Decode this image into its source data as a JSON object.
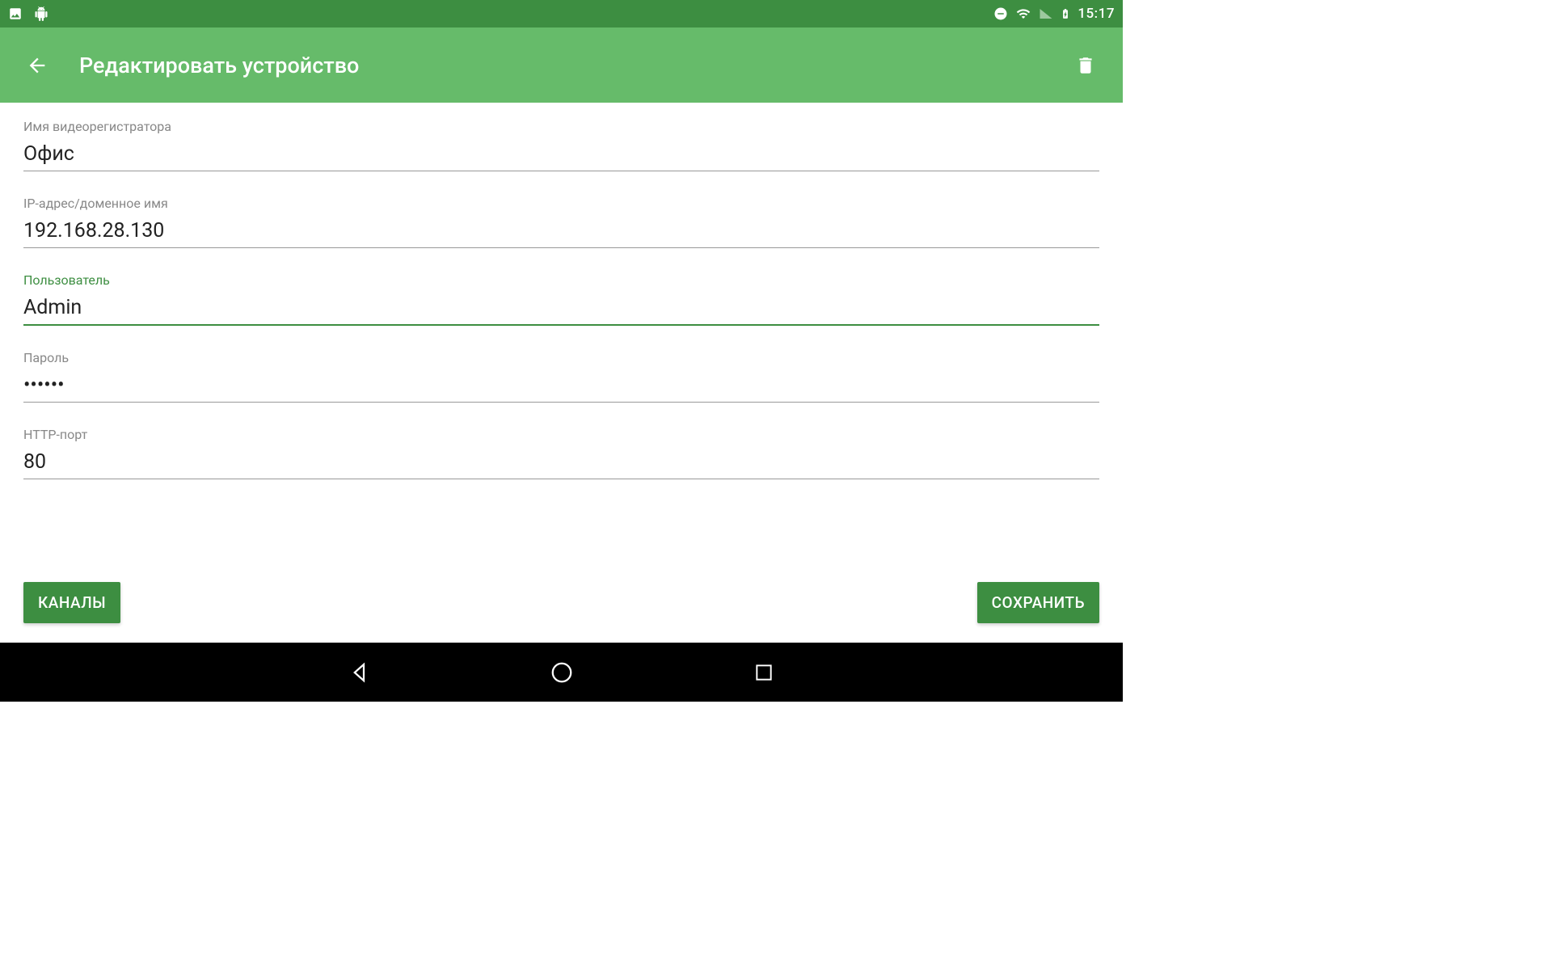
{
  "status": {
    "time": "15:17"
  },
  "header": {
    "title": "Редактировать устройство"
  },
  "fields": {
    "name": {
      "label": "Имя видеорегистратора",
      "value": "Офис"
    },
    "ip": {
      "label": "IP-адрес/доменное имя",
      "value": "192.168.28.130"
    },
    "user": {
      "label": "Пользователь",
      "value": "Admin"
    },
    "pass": {
      "label": "Пароль",
      "value": "••••••"
    },
    "port": {
      "label": "HTTP-порт",
      "value": "80"
    }
  },
  "buttons": {
    "channels": "КАНАЛЫ",
    "save": "СОХРАНИТЬ"
  }
}
